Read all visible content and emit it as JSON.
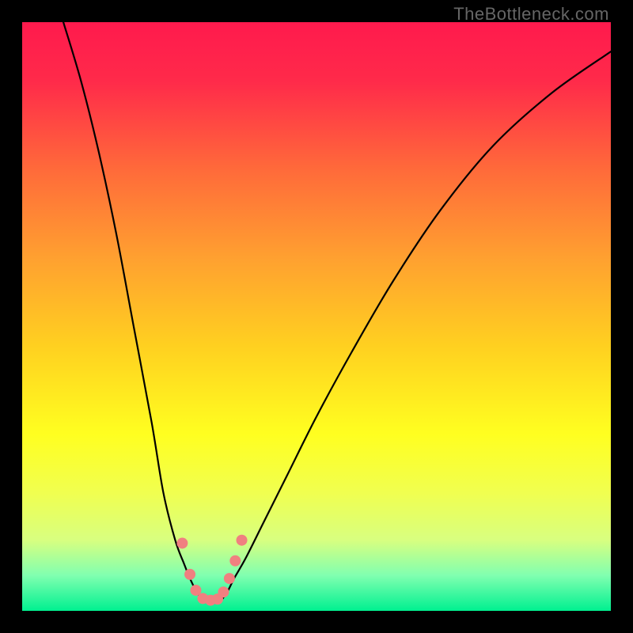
{
  "watermark": "TheBottleneck.com",
  "chart_data": {
    "type": "line",
    "title": "",
    "xlabel": "",
    "ylabel": "",
    "xlim": [
      0,
      100
    ],
    "ylim": [
      0,
      100
    ],
    "gradient_stops": [
      {
        "offset": 0.0,
        "color": "#ff1a4d"
      },
      {
        "offset": 0.1,
        "color": "#ff2a4a"
      },
      {
        "offset": 0.25,
        "color": "#ff6a3a"
      },
      {
        "offset": 0.4,
        "color": "#ffa030"
      },
      {
        "offset": 0.55,
        "color": "#ffd020"
      },
      {
        "offset": 0.7,
        "color": "#ffff20"
      },
      {
        "offset": 0.8,
        "color": "#f0ff50"
      },
      {
        "offset": 0.88,
        "color": "#d8ff80"
      },
      {
        "offset": 0.94,
        "color": "#80ffb0"
      },
      {
        "offset": 1.0,
        "color": "#00f090"
      }
    ],
    "series": [
      {
        "name": "left_curve",
        "x": [
          7,
          10,
          13,
          16,
          19,
          22,
          24,
          26,
          27.5,
          28.5,
          29.5,
          30.5
        ],
        "y": [
          100,
          90,
          78,
          64,
          48,
          32,
          20,
          12,
          8,
          5.5,
          3.5,
          2
        ]
      },
      {
        "name": "right_curve",
        "x": [
          34,
          35,
          36,
          38,
          41,
          45,
          50,
          56,
          63,
          71,
          80,
          90,
          100
        ],
        "y": [
          2,
          3.5,
          5.5,
          9,
          15,
          23,
          33,
          44,
          56,
          68,
          79,
          88,
          95
        ]
      },
      {
        "name": "bottom_flat",
        "x": [
          30.5,
          31.5,
          32.5,
          33.5,
          34
        ],
        "y": [
          2,
          1.8,
          1.8,
          1.8,
          2
        ]
      }
    ],
    "markers": [
      {
        "x": 27.2,
        "y": 11.5,
        "r": 7
      },
      {
        "x": 28.5,
        "y": 6.2,
        "r": 7
      },
      {
        "x": 29.5,
        "y": 3.5,
        "r": 7
      },
      {
        "x": 30.7,
        "y": 2.1,
        "r": 7
      },
      {
        "x": 32.0,
        "y": 1.8,
        "r": 7
      },
      {
        "x": 33.2,
        "y": 2.0,
        "r": 7
      },
      {
        "x": 34.2,
        "y": 3.2,
        "r": 7
      },
      {
        "x": 35.2,
        "y": 5.5,
        "r": 7
      },
      {
        "x": 36.2,
        "y": 8.5,
        "r": 7
      },
      {
        "x": 37.3,
        "y": 12.0,
        "r": 7
      }
    ],
    "marker_color": "#f08080"
  }
}
